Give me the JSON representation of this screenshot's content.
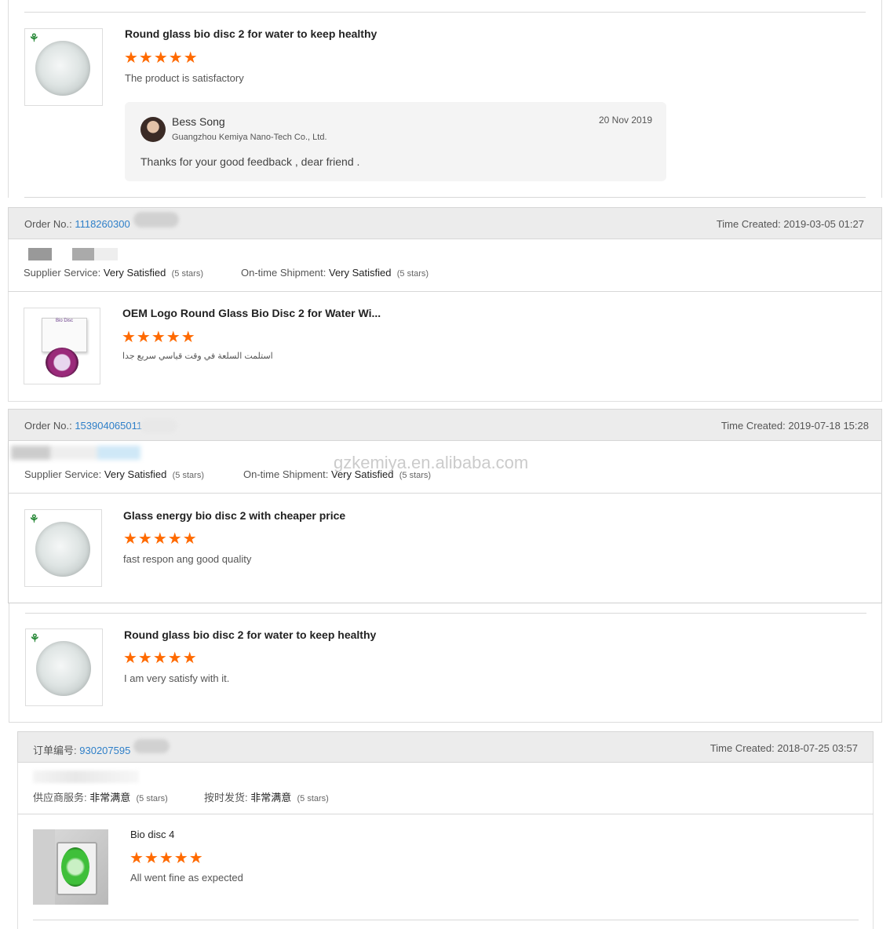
{
  "review1": {
    "title": "Round glass bio disc 2 for water to keep healthy",
    "stars": "★★★★★",
    "text": "The product is satisfactory",
    "reply": {
      "name": "Bess Song",
      "company": "Guangzhou Kemiya Nano-Tech Co., Ltd.",
      "date": "20 Nov 2019",
      "text": "Thanks for your good feedback , dear friend ."
    }
  },
  "order2": {
    "order_label": "Order No.:",
    "order_no": "1118260300",
    "time_label": "Time Created:",
    "time": "2019-03-05 01:27",
    "supplier_label": "Supplier Service:",
    "supplier_value": "Very Satisfied",
    "supplier_stars": "(5 stars)",
    "shipment_label": "On-time Shipment:",
    "shipment_value": "Very Satisfied",
    "shipment_stars": "(5 stars)",
    "title": "OEM Logo Round Glass Bio Disc 2 for Water Wi...",
    "stars": "★★★★★",
    "text": "استلمت السلعة في وقت قياسي سريع جدا",
    "box_label": "Bio Disc"
  },
  "order3": {
    "order_label": "Order No.:",
    "order_no": "153904065011",
    "time_label": "Time Created:",
    "time": "2019-07-18 15:28",
    "supplier_label": "Supplier Service:",
    "supplier_value": "Very Satisfied",
    "supplier_stars": "(5 stars)",
    "shipment_label": "On-time Shipment:",
    "shipment_value": "Very Satisfied",
    "shipment_stars": "(5 stars)",
    "title": "Glass energy bio disc 2 with cheaper price",
    "stars": "★★★★★",
    "text": "fast respon ang good quality"
  },
  "watermark": "gzkemiya.en.alibaba.com",
  "review4": {
    "title": "Round glass bio disc 2 for water to keep healthy",
    "stars": "★★★★★",
    "text": "I am very satisfy with it."
  },
  "order5": {
    "order_label": "订单编号:",
    "order_no": "930207595",
    "time_label": "Time Created:",
    "time": "2018-07-25 03:57",
    "supplier_label": "供应商服务:",
    "supplier_value": "非常满意",
    "supplier_stars": "(5 stars)",
    "shipment_label": "按时发货:",
    "shipment_value": "非常满意",
    "shipment_stars": "(5 stars)",
    "title": "Bio disc 4",
    "stars": "★★★★★",
    "text": "All went fine as expected"
  },
  "colors": {
    "link": "#2e7fc8",
    "star": "#ff6a00",
    "header_bg": "#ececec"
  }
}
